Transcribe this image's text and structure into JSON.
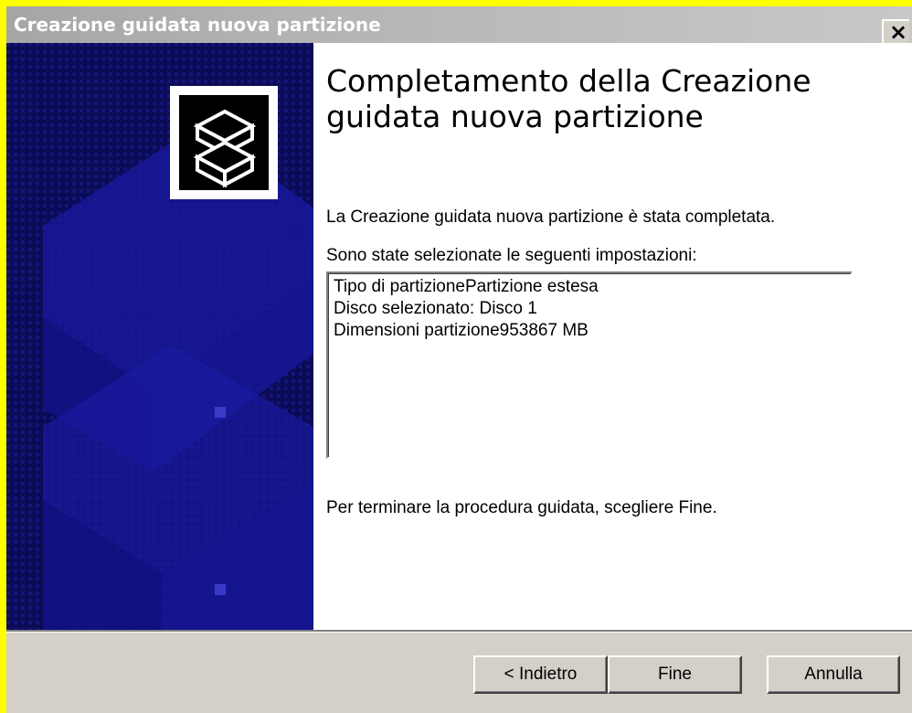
{
  "window": {
    "title": "Creazione guidata nuova partizione",
    "close_glyph": "✕"
  },
  "heading": "Completamento della Creazione guidata nuova partizione",
  "completed_text": "La Creazione guidata nuova partizione è stata completata.",
  "settings_label": "Sono state selezionate le seguenti impostazioni:",
  "summary": [
    "Tipo di partizionePartizione estesa",
    "Disco selezionato: Disco 1",
    "Dimensioni partizione953867 MB"
  ],
  "finish_instructions": "Per terminare la procedura guidata, scegliere Fine.",
  "buttons": {
    "back": "< Indietro",
    "finish": "Fine",
    "cancel": "Annulla"
  },
  "colors": {
    "side_panel": "#0b0b56",
    "title_bar": "#b0b0b0",
    "frame": "#d4d0c8",
    "outer": "#ffff00"
  },
  "icons": {
    "wizard_logo": "stacked-disks-icon",
    "close": "close-icon"
  }
}
